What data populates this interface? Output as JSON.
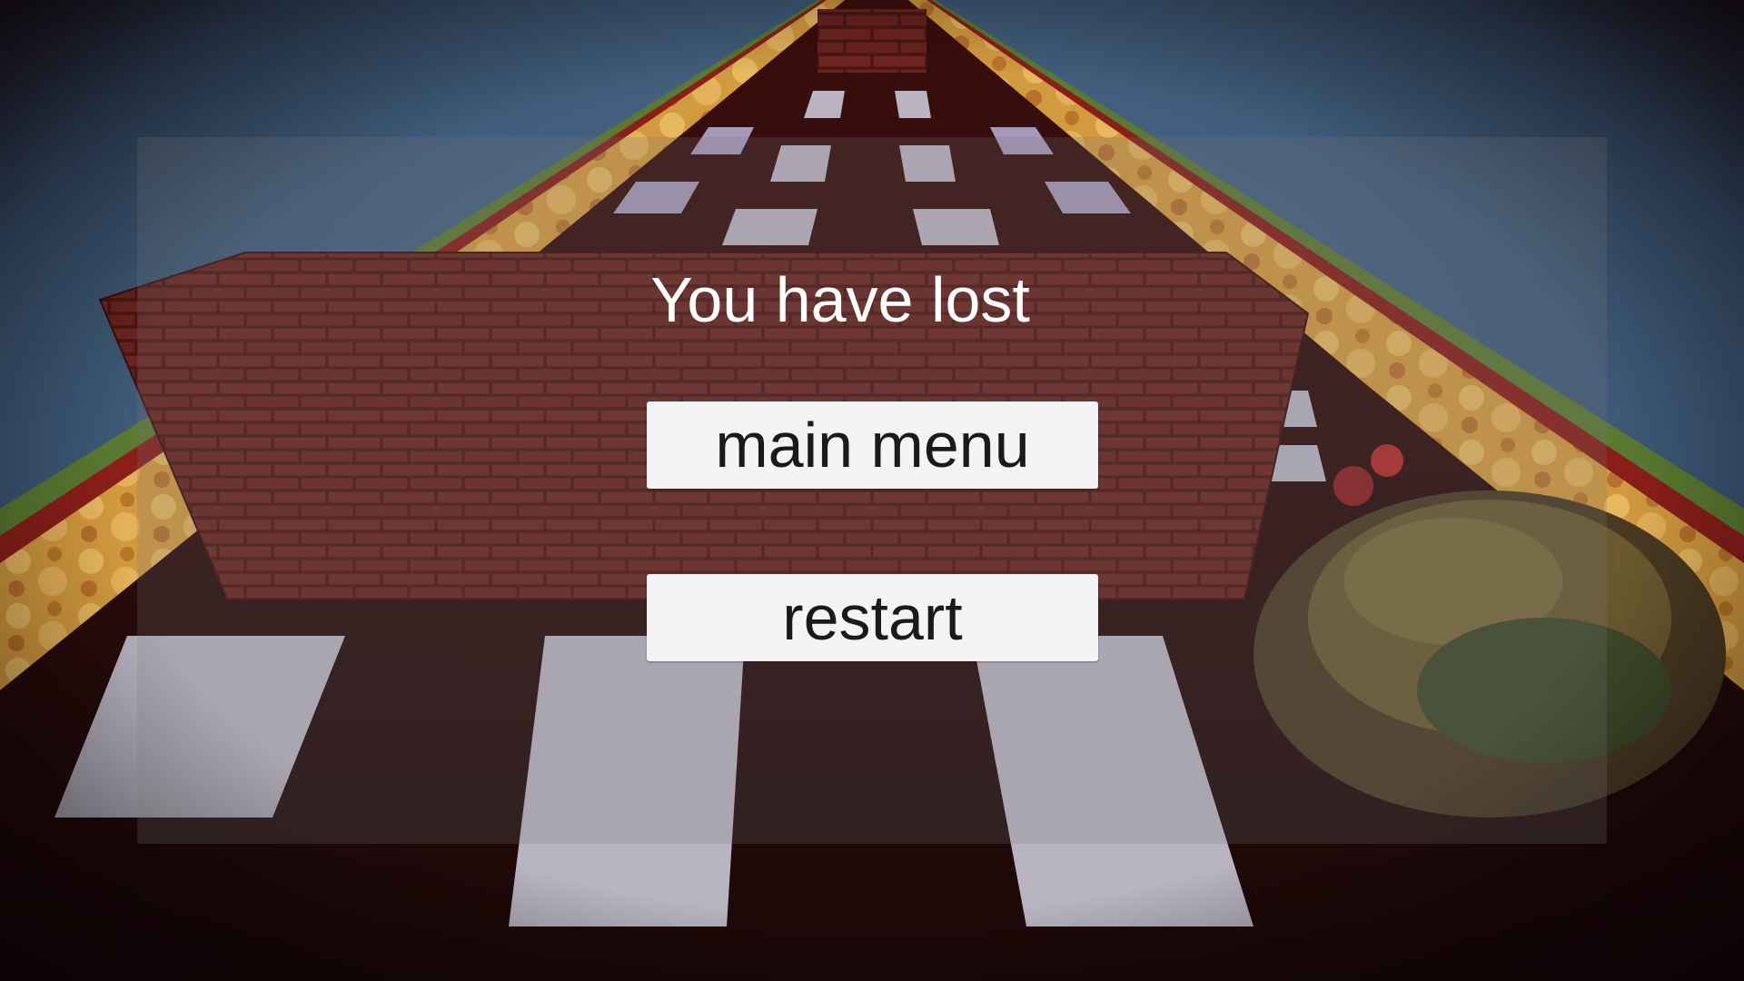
{
  "screen": {
    "title": "You have lost"
  },
  "buttons": {
    "main_menu_label": "main menu",
    "restart_label": "restart"
  },
  "colors": {
    "sky": "#3f5b78",
    "brick": "#6b1f1a",
    "lava": "#d9a04a",
    "grass_edge": "#5a7a2e",
    "button_bg": "#f4f4f4",
    "title_text": "#ffffff"
  }
}
